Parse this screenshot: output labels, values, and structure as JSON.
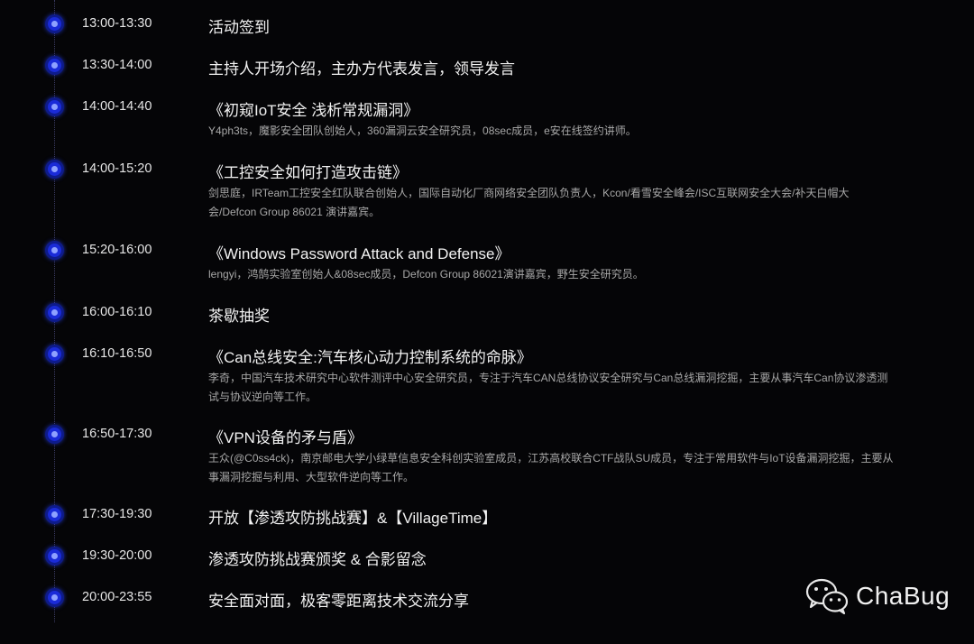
{
  "schedule": [
    {
      "time": "13:00-13:30",
      "title": "活动签到",
      "desc": ""
    },
    {
      "time": "13:30-14:00",
      "title": "主持人开场介绍，主办方代表发言，领导发言",
      "desc": ""
    },
    {
      "time": "14:00-14:40",
      "title": "《初窥IoT安全 浅析常规漏洞》",
      "desc": "Y4ph3ts，魔影安全团队创始人，360漏洞云安全研究员，08sec成员，e安在线签约讲师。"
    },
    {
      "time": "14:00-15:20",
      "title": "《工控安全如何打造攻击链》",
      "desc": "剑思庭，IRTeam工控安全红队联合创始人，国际自动化厂商网络安全团队负责人，Kcon/看雪安全峰会/ISC互联网安全大会/补天白帽大会/Defcon Group 86021 演讲嘉宾。"
    },
    {
      "time": "15:20-16:00",
      "title": "《Windows Password Attack and Defense》",
      "desc": "lengyi，鸿鹄实验室创始人&08sec成员，Defcon Group 86021演讲嘉宾，野生安全研究员。"
    },
    {
      "time": "16:00-16:10",
      "title": "茶歇抽奖",
      "desc": ""
    },
    {
      "time": "16:10-16:50",
      "title": "《Can总线安全:汽车核心动力控制系统的命脉》",
      "desc": "李奇，中国汽车技术研究中心软件测评中心安全研究员，专注于汽车CAN总线协议安全研究与Can总线漏洞挖掘，主要从事汽车Can协议渗透测试与协议逆向等工作。"
    },
    {
      "time": "16:50-17:30",
      "title": "《VPN设备的矛与盾》",
      "desc": "王众(@C0ss4ck)，南京邮电大学小绿草信息安全科创实验室成员，江苏高校联合CTF战队SU成员，专注于常用软件与IoT设备漏洞挖掘，主要从事漏洞挖掘与利用、大型软件逆向等工作。"
    },
    {
      "time": "17:30-19:30",
      "title": "开放【渗透攻防挑战赛】&【VillageTime】",
      "desc": ""
    },
    {
      "time": "19:30-20:00",
      "title": "渗透攻防挑战赛颁奖 & 合影留念",
      "desc": ""
    },
    {
      "time": "20:00-23:55",
      "title": "安全面对面，极客零距离技术交流分享",
      "desc": ""
    }
  ],
  "brand": {
    "name": "ChaBug",
    "icon": "wechat-icon"
  },
  "colors": {
    "background": "#050507",
    "dot": "#1a2bd8",
    "text": "#e8e8e8",
    "desc": "#a8a8a8"
  }
}
